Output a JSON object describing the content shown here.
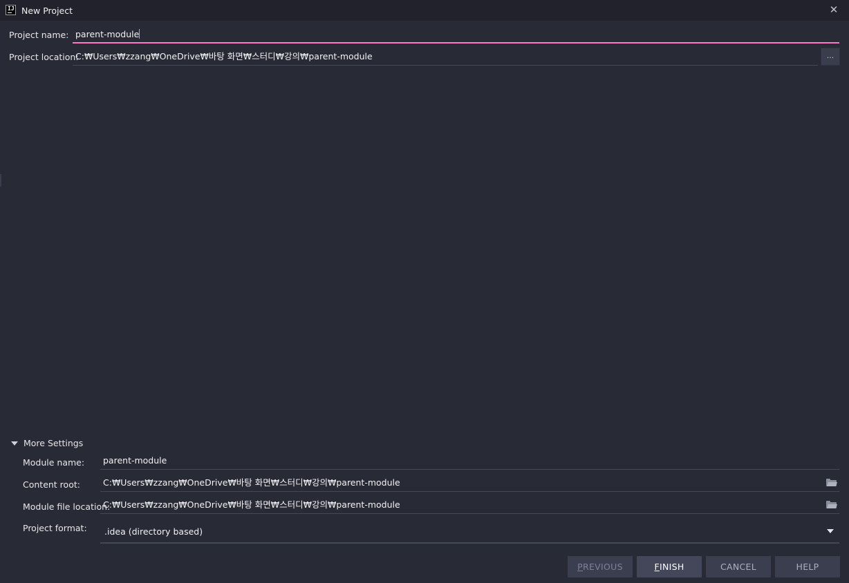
{
  "window": {
    "title": "New Project",
    "app_icon_text": "IJ"
  },
  "project": {
    "name_label": "Project name:",
    "name_value": "parent-module",
    "location_label": "Project location:",
    "location_value": "C:₩Users₩zzang₩OneDrive₩바탕 화면₩스터디₩강의₩parent-module",
    "browse_label": "..."
  },
  "more_settings": {
    "label": "More Settings",
    "module_name_label": "Module name:",
    "module_name_value": "parent-module",
    "content_root_label": "Content root:",
    "content_root_value": "C:₩Users₩zzang₩OneDrive₩바탕 화면₩스터디₩강의₩parent-module",
    "module_file_label": "Module file location:",
    "module_file_value": "C:₩Users₩zzang₩OneDrive₩바탕 화면₩스터디₩강의₩parent-module",
    "project_format_label": "Project format:",
    "project_format_value": ".idea (directory based)"
  },
  "buttons": {
    "previous": {
      "first": "P",
      "rest": "REVIOUS"
    },
    "finish": {
      "first": "F",
      "rest": "INISH"
    },
    "cancel": "CANCEL",
    "help": "HELP"
  },
  "colors": {
    "accent": "#ff79c6",
    "background": "#282a36",
    "titlebar": "#21222c"
  }
}
